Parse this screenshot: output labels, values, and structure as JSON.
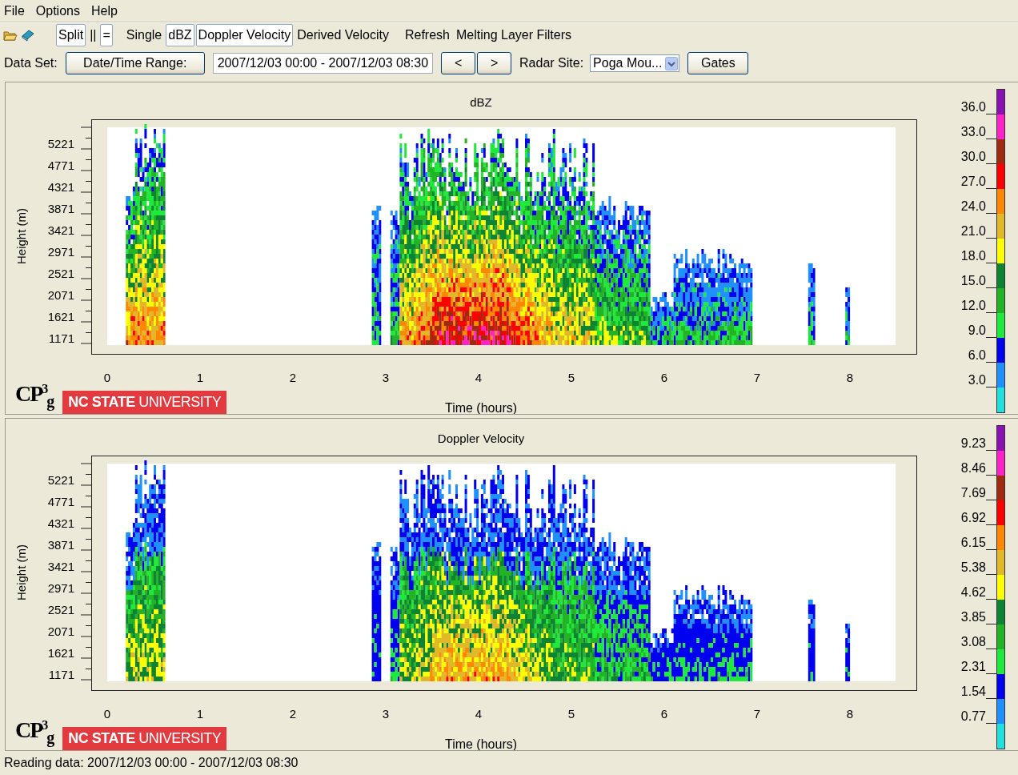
{
  "menu": [
    {
      "label": "File"
    },
    {
      "label": "Options"
    },
    {
      "label": "Help"
    }
  ],
  "toolbar": [
    {
      "label": "Split",
      "selected": true
    },
    {
      "label": "||",
      "selected": false
    },
    {
      "label": "=",
      "selected": true
    },
    {
      "label": "Single",
      "selected": false
    },
    {
      "label": "dBZ",
      "selected": true
    },
    {
      "label": "Doppler Velocity",
      "selected": true
    },
    {
      "label": "Derived Velocity",
      "selected": false
    },
    {
      "label": "Refresh",
      "selected": false
    },
    {
      "label": "Melting Layer Filters",
      "selected": false
    }
  ],
  "dataset": {
    "label": "Data Set:",
    "range_button": "Date/Time Range:",
    "range_value": "2007/12/03 00:00 - 2007/12/03 08:30",
    "prev_button": "<",
    "next_button": ">",
    "site_label": "Radar Site:",
    "site_value": "Poga Mou...",
    "gates_button": "Gates"
  },
  "panels": [
    {
      "kind": "reflectivity",
      "title": "dBZ",
      "ylabel": "Height (m)",
      "xlabel": "Time (hours)",
      "yticks": [
        "5221",
        "4771",
        "4321",
        "3871",
        "3421",
        "2971",
        "2521",
        "2071",
        "1621",
        "1171"
      ],
      "xticks": [
        "0",
        "1",
        "2",
        "3",
        "4",
        "5",
        "6",
        "7",
        "8"
      ],
      "logo": "CP$^{3}$$_{g}$",
      "banner": "**NC STATE** UNIVERSITY",
      "legend_labels": [
        "36.0",
        "33.0",
        "30.0",
        "27.0",
        "24.0",
        "21.0",
        "18.0",
        "15.0",
        "12.0",
        "9.0",
        "6.0",
        "3.0"
      ],
      "legend_colors": [
        {
          "color": "#8a12b4"
        },
        {
          "color": "#ff22c8"
        },
        {
          "color": "#a02a10"
        },
        {
          "color": "#ff0000"
        },
        {
          "color": "#ff8800"
        },
        {
          "color": "#e0b828"
        },
        {
          "color": "#ffff00"
        },
        {
          "color": "#0c8434"
        },
        {
          "color": "#22b424"
        },
        {
          "color": "#1eea3c"
        },
        {
          "color": "#0000f0"
        },
        {
          "color": "#1e90ff"
        },
        {
          "color": "#22e0e0"
        }
      ]
    },
    {
      "kind": "velocity",
      "title": "Doppler Velocity",
      "ylabel": "Height (m)",
      "xlabel": "Time (hours)",
      "yticks": [
        "5221",
        "4771",
        "4321",
        "3871",
        "3421",
        "2971",
        "2521",
        "2071",
        "1621",
        "1171"
      ],
      "xticks": [
        "0",
        "1",
        "2",
        "3",
        "4",
        "5",
        "6",
        "7",
        "8"
      ],
      "logo": "CP$^{3}$$_{g}$",
      "banner": "**NC STATE** UNIVERSITY",
      "legend_labels": [
        "9.23",
        "8.46",
        "7.69",
        "6.92",
        "6.15",
        "5.38",
        "4.62",
        "3.85",
        "3.08",
        "2.31",
        "1.54",
        "0.77"
      ],
      "legend_colors": [
        {
          "color": "#8a12b4"
        },
        {
          "color": "#ff22c8"
        },
        {
          "color": "#a02a10"
        },
        {
          "color": "#ff0000"
        },
        {
          "color": "#ff8800"
        },
        {
          "color": "#e0b828"
        },
        {
          "color": "#ffff00"
        },
        {
          "color": "#0c8434"
        },
        {
          "color": "#22b424"
        },
        {
          "color": "#1eea3c"
        },
        {
          "color": "#0000f0"
        },
        {
          "color": "#1e90ff"
        },
        {
          "color": "#22e0e0"
        }
      ]
    }
  ],
  "status_bar": "Reading data: 2007/12/03 00:00 - 2007/12/03 08:30"
}
